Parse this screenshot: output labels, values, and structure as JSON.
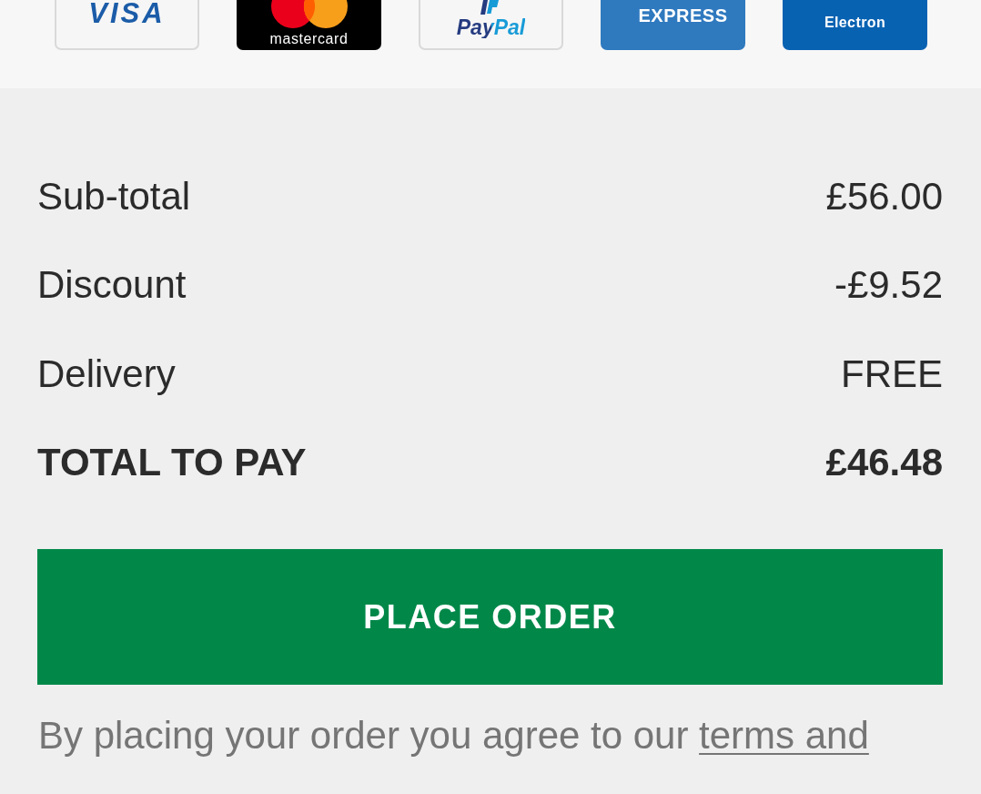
{
  "payment_methods": [
    {
      "kind": "visa",
      "label": "VISA"
    },
    {
      "kind": "mastercard",
      "label": "mastercard"
    },
    {
      "kind": "paypal",
      "label": "PayPal"
    },
    {
      "kind": "amex",
      "label": "EXPRESS"
    },
    {
      "kind": "visa_electron",
      "label": "Electron"
    }
  ],
  "summary": {
    "rows": [
      {
        "label": "Sub-total",
        "value": "£56.00"
      },
      {
        "label": "Discount",
        "value": "-£9.52"
      },
      {
        "label": "Delivery",
        "value": "FREE"
      }
    ],
    "total": {
      "label": "TOTAL TO PAY",
      "value": "£46.48"
    }
  },
  "place_order_button": {
    "label": "PLACE ORDER"
  },
  "terms_note": {
    "text": "By placing your order you agree to our ",
    "link": "terms and"
  }
}
